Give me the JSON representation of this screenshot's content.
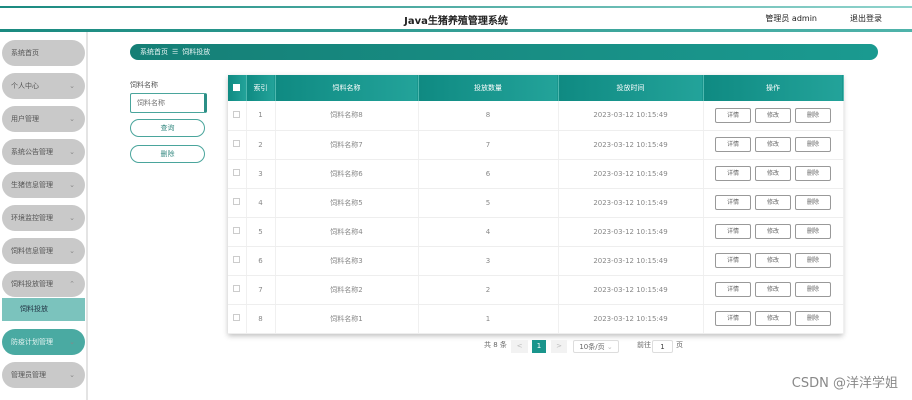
{
  "header": {
    "title": "Java生猪养殖管理系统",
    "user": "管理员 admin",
    "logout": "退出登录"
  },
  "sidebar": {
    "items": [
      {
        "label": "系统首页",
        "chevron": ""
      },
      {
        "label": "个人中心",
        "chevron": "⌄"
      },
      {
        "label": "用户管理",
        "chevron": "⌄"
      },
      {
        "label": "系统公告管理",
        "chevron": "⌄"
      },
      {
        "label": "生猪信息管理",
        "chevron": "⌄"
      },
      {
        "label": "环境监控管理",
        "chevron": "⌄"
      },
      {
        "label": "饲料信息管理",
        "chevron": "⌄"
      },
      {
        "label": "饲料投放管理",
        "chevron": "⌃"
      },
      {
        "label": "防疫计划管理",
        "chevron": "⌄"
      },
      {
        "label": "管理员管理",
        "chevron": "⌄"
      }
    ],
    "sub_item": "饲料投放"
  },
  "breadcrumb": {
    "home": "系统首页",
    "sep": "☰",
    "current": "饲料投放"
  },
  "search": {
    "label": "饲料名称",
    "placeholder": "饲料名称",
    "query": "查询",
    "delete": "删除"
  },
  "table": {
    "headers": [
      "索引",
      "饲料名称",
      "投放数量",
      "投放时间",
      "操作"
    ],
    "rows": [
      {
        "idx": "1",
        "name": "饲料名称8",
        "qty": "8",
        "time": "2023-03-12 10:15:49"
      },
      {
        "idx": "2",
        "name": "饲料名称7",
        "qty": "7",
        "time": "2023-03-12 10:15:49"
      },
      {
        "idx": "3",
        "name": "饲料名称6",
        "qty": "6",
        "time": "2023-03-12 10:15:49"
      },
      {
        "idx": "4",
        "name": "饲料名称5",
        "qty": "5",
        "time": "2023-03-12 10:15:49"
      },
      {
        "idx": "5",
        "name": "饲料名称4",
        "qty": "4",
        "time": "2023-03-12 10:15:49"
      },
      {
        "idx": "6",
        "name": "饲料名称3",
        "qty": "3",
        "time": "2023-03-12 10:15:49"
      },
      {
        "idx": "7",
        "name": "饲料名称2",
        "qty": "2",
        "time": "2023-03-12 10:15:49"
      },
      {
        "idx": "8",
        "name": "饲料名称1",
        "qty": "1",
        "time": "2023-03-12 10:15:49"
      }
    ],
    "ops": {
      "detail": "详情",
      "edit": "修改",
      "delete": "删除"
    }
  },
  "pagination": {
    "total": "共 8 条",
    "prev": "<",
    "page": "1",
    "next": ">",
    "size": "10条/页",
    "goto": "前往",
    "goto_value": "1",
    "page_unit": "页"
  },
  "watermark": "CSDN @洋洋学姐"
}
